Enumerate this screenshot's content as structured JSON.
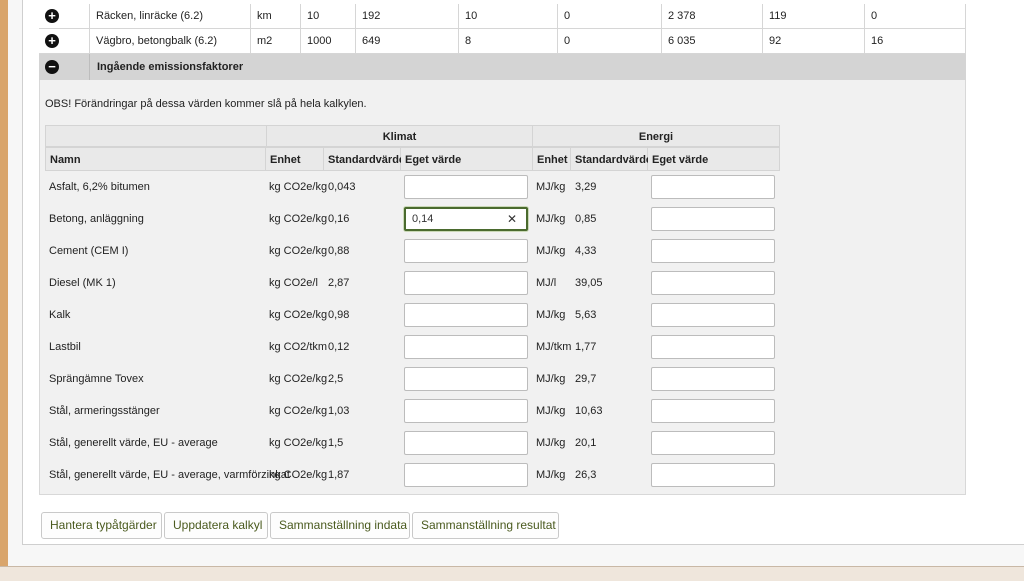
{
  "rows": [
    {
      "name": "Räcken, linräcke (6.2)",
      "unit": "km",
      "c1": "10",
      "c2": "192",
      "c3": "10",
      "c4": "0",
      "c5": "2 378",
      "c6": "119",
      "c7": "0"
    },
    {
      "name": "Vägbro, betongbalk (6.2)",
      "unit": "m2",
      "c1": "1000",
      "c2": "649",
      "c3": "8",
      "c4": "0",
      "c5": "6 035",
      "c6": "92",
      "c7": "16"
    }
  ],
  "section": {
    "title": "Ingående emissionsfaktorer"
  },
  "notice": "OBS! Förändringar på dessa värden kommer slå på hela kalkylen.",
  "table": {
    "group_klimat": "Klimat",
    "group_energi": "Energi",
    "col_namn": "Namn",
    "col_enhet": "Enhet",
    "col_standard": "Standardvärde",
    "col_eget": "Eget värde",
    "col_enhet2": "Enhet",
    "col_standard2": "Standardvärde",
    "col_eget2": "Eget värde",
    "rows": [
      {
        "name": "Asfalt, 6,2% bitumen",
        "k_unit": "kg CO2e/kg",
        "k_std": "0,043",
        "k_own": "",
        "e_unit": "MJ/kg",
        "e_std": "3,29",
        "e_own": ""
      },
      {
        "name": "Betong, anläggning",
        "k_unit": "kg CO2e/kg",
        "k_std": "0,16",
        "k_own": "0,14",
        "e_unit": "MJ/kg",
        "e_std": "0,85",
        "e_own": ""
      },
      {
        "name": "Cement (CEM I)",
        "k_unit": "kg CO2e/kg",
        "k_std": "0,88",
        "k_own": "",
        "e_unit": "MJ/kg",
        "e_std": "4,33",
        "e_own": ""
      },
      {
        "name": "Diesel (MK 1)",
        "k_unit": "kg CO2e/l",
        "k_std": "2,87",
        "k_own": "",
        "e_unit": "MJ/l",
        "e_std": "39,05",
        "e_own": ""
      },
      {
        "name": "Kalk",
        "k_unit": "kg CO2e/kg",
        "k_std": "0,98",
        "k_own": "",
        "e_unit": "MJ/kg",
        "e_std": "5,63",
        "e_own": ""
      },
      {
        "name": "Lastbil",
        "k_unit": "kg CO2/tkm",
        "k_std": "0,12",
        "k_own": "",
        "e_unit": "MJ/tkm",
        "e_std": "1,77",
        "e_own": ""
      },
      {
        "name": "Sprängämne Tovex",
        "k_unit": "kg CO2e/kg",
        "k_std": "2,5",
        "k_own": "",
        "e_unit": "MJ/kg",
        "e_std": "29,7",
        "e_own": ""
      },
      {
        "name": "Stål, armeringsstänger",
        "k_unit": "kg CO2e/kg",
        "k_std": "1,03",
        "k_own": "",
        "e_unit": "MJ/kg",
        "e_std": "10,63",
        "e_own": ""
      },
      {
        "name": "Stål, generellt värde, EU - average",
        "k_unit": "kg CO2e/kg",
        "k_std": "1,5",
        "k_own": "",
        "e_unit": "MJ/kg",
        "e_std": "20,1",
        "e_own": ""
      },
      {
        "name": "Stål, generellt värde, EU - average, varmförzinkat",
        "k_unit": "kg CO2e/kg",
        "k_std": "1,87",
        "k_own": "",
        "e_unit": "MJ/kg",
        "e_std": "26,3",
        "e_own": ""
      }
    ]
  },
  "buttons": {
    "manage": "Hantera typåtgärder",
    "update": "Uppdatera kalkyl",
    "summary_input": "Sammanställning indata",
    "summary_result": "Sammanställning resultat"
  },
  "icons": {
    "expand": "plus-circle-icon",
    "collapse": "minus-circle-icon",
    "clear": "clear-x-icon"
  },
  "colors": {
    "button_text": "#4a5a1e",
    "section_bg": "#d4d4d4",
    "frame": "#d9a56c"
  }
}
